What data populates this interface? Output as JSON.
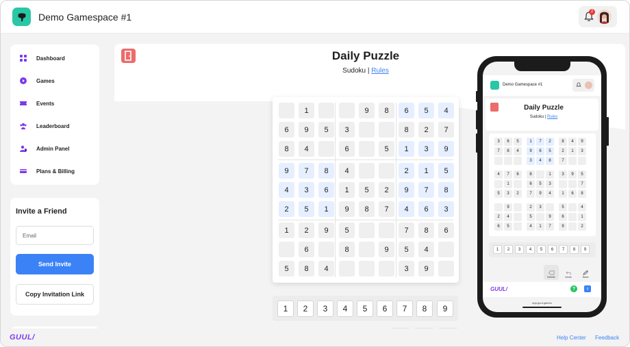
{
  "header": {
    "workspace_title": "Demo Gamespace #1",
    "notification_count": "2"
  },
  "sidebar": {
    "items": [
      {
        "label": "Dashboard",
        "icon": "grid-icon"
      },
      {
        "label": "Games",
        "icon": "play-icon"
      },
      {
        "label": "Events",
        "icon": "ticket-icon"
      },
      {
        "label": "Leaderboard",
        "icon": "users-icon"
      },
      {
        "label": "Admin Panel",
        "icon": "user-shield-icon"
      },
      {
        "label": "Plans & Billing",
        "icon": "card-icon"
      }
    ]
  },
  "invite": {
    "title": "Invite a Friend",
    "email_placeholder": "Email",
    "send_label": "Send Invite",
    "copy_label": "Copy Invitation Link"
  },
  "puzzle": {
    "title": "Daily Puzzle",
    "game": "Sudoku",
    "separator": "|",
    "rules_label": "Rules"
  },
  "board": {
    "rows": [
      [
        "",
        "1",
        "",
        "",
        "9",
        "8",
        "6",
        "5",
        "4"
      ],
      [
        "6",
        "9",
        "5",
        "3",
        "",
        "",
        "8",
        "2",
        "7"
      ],
      [
        "8",
        "4",
        "",
        "6",
        "",
        "5",
        "1",
        "3",
        "9"
      ],
      [
        "9",
        "7",
        "8",
        "4",
        "",
        "",
        "2",
        "1",
        "5"
      ],
      [
        "4",
        "3",
        "6",
        "1",
        "5",
        "2",
        "9",
        "7",
        "8"
      ],
      [
        "2",
        "5",
        "1",
        "9",
        "8",
        "7",
        "4",
        "6",
        "3"
      ],
      [
        "1",
        "2",
        "9",
        "5",
        "",
        "",
        "7",
        "8",
        "6"
      ],
      [
        "",
        "6",
        "",
        "8",
        "",
        "9",
        "5",
        "4",
        ""
      ],
      [
        "5",
        "8",
        "4",
        "",
        "",
        "",
        "3",
        "9",
        ""
      ]
    ],
    "user_cells": [
      [
        0,
        6
      ],
      [
        0,
        7
      ],
      [
        0,
        8
      ],
      [
        2,
        6
      ],
      [
        2,
        7
      ],
      [
        2,
        8
      ],
      [
        3,
        0
      ],
      [
        3,
        1
      ],
      [
        3,
        2
      ],
      [
        3,
        6
      ],
      [
        3,
        7
      ],
      [
        3,
        8
      ],
      [
        4,
        0
      ],
      [
        4,
        1
      ],
      [
        4,
        2
      ],
      [
        4,
        6
      ],
      [
        4,
        7
      ],
      [
        4,
        8
      ],
      [
        5,
        0
      ],
      [
        5,
        1
      ],
      [
        5,
        2
      ],
      [
        5,
        6
      ],
      [
        5,
        7
      ],
      [
        5,
        8
      ]
    ]
  },
  "keypad": [
    "1",
    "2",
    "3",
    "4",
    "5",
    "6",
    "7",
    "8",
    "9"
  ],
  "footer": {
    "brand": "GUUL/",
    "help_label": "Help Center",
    "feedback_label": "Feedback"
  },
  "phone": {
    "workspace_title": "Demo Gamespace #1",
    "puzzle_title": "Daily Puzzle",
    "game": "Sudoku",
    "separator": "|",
    "rules_label": "Rules",
    "rows": [
      [
        "3",
        "6",
        "5",
        "1",
        "7",
        "2",
        "8",
        "4",
        "9"
      ],
      [
        "7",
        "8",
        "4",
        "9",
        "6",
        "5",
        "2",
        "1",
        "3"
      ],
      [
        "",
        "",
        "",
        "3",
        "4",
        "8",
        "7",
        "",
        ""
      ],
      [
        "4",
        "7",
        "6",
        "8",
        "",
        "1",
        "3",
        "9",
        "5"
      ],
      [
        "",
        "1",
        "",
        "6",
        "5",
        "3",
        "",
        "",
        "7"
      ],
      [
        "5",
        "3",
        "2",
        "7",
        "9",
        "4",
        "1",
        "6",
        "8"
      ],
      [
        "",
        "9",
        "",
        "2",
        "3",
        "",
        "5",
        "",
        "4"
      ],
      [
        "2",
        "4",
        "",
        "5",
        "",
        "9",
        "6",
        "",
        "1"
      ],
      [
        "6",
        "5",
        "",
        "4",
        "1",
        "7",
        "9",
        "",
        "2"
      ]
    ],
    "user_cells": [
      [
        0,
        3
      ],
      [
        0,
        4
      ],
      [
        0,
        5
      ],
      [
        1,
        3
      ],
      [
        1,
        4
      ],
      [
        1,
        5
      ],
      [
        2,
        3
      ],
      [
        2,
        4
      ],
      [
        2,
        5
      ]
    ],
    "keypad": [
      "1",
      "2",
      "3",
      "4",
      "5",
      "6",
      "7",
      "8",
      "9"
    ],
    "tools": {
      "delete_label": "Delete",
      "undo_label": "Undo",
      "save_label": "Save"
    },
    "brand": "GUUL/",
    "help_glyph": "?",
    "url": "app.guul.games"
  },
  "colors": {
    "accent": "#3b82f6",
    "brand": "#7c3aed",
    "logo": "#29c7a6",
    "user_cell": "#e6efff"
  }
}
